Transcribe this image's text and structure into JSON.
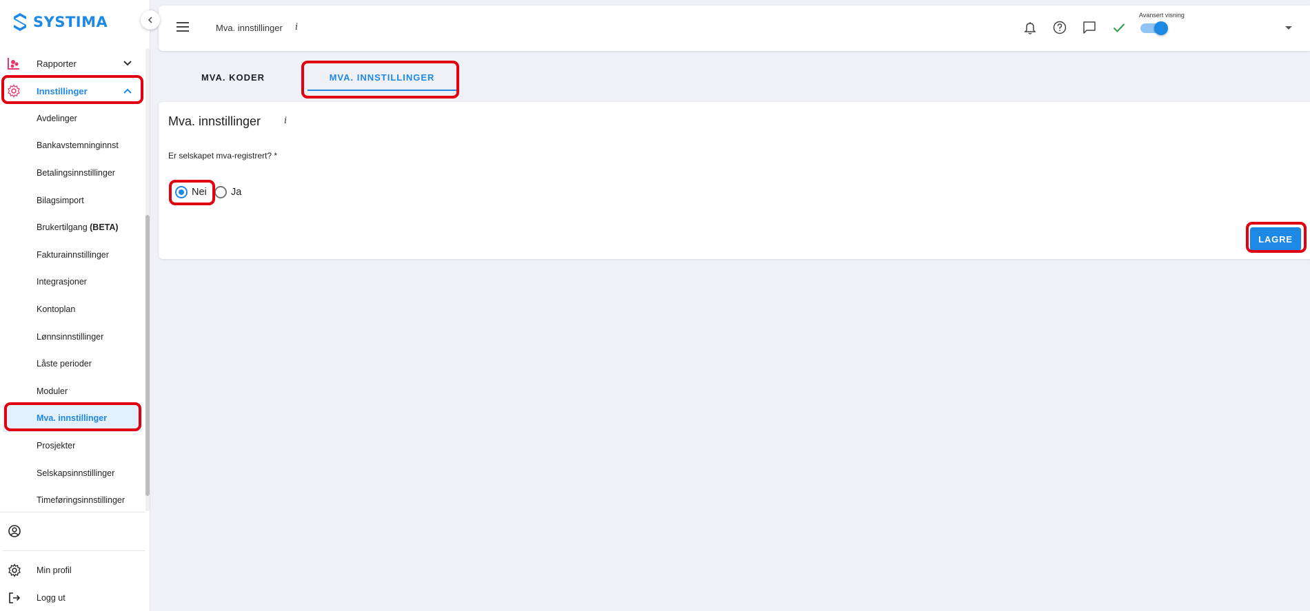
{
  "app": {
    "logo_text": "SYSTIMA"
  },
  "sidebar": {
    "sections": [
      {
        "label": "Rapporter",
        "icon": "bar-chart-icon",
        "expanded": false
      },
      {
        "label": "Innstillinger",
        "icon": "gear-icon",
        "expanded": true
      }
    ],
    "settings_items": [
      {
        "label": "Avdelinger"
      },
      {
        "label": "Bankavstemninginnst"
      },
      {
        "label": "Betalingsinnstillinger"
      },
      {
        "label": "Bilagsimport"
      },
      {
        "label": "Brukertilgang ",
        "badge": "(BETA)"
      },
      {
        "label": "Fakturainnstillinger"
      },
      {
        "label": "Integrasjoner"
      },
      {
        "label": "Kontoplan"
      },
      {
        "label": "Lønnsinnstillinger"
      },
      {
        "label": "Låste perioder"
      },
      {
        "label": "Moduler"
      },
      {
        "label": "Mva. innstillinger",
        "active": true
      },
      {
        "label": "Prosjekter"
      },
      {
        "label": "Selskapsinnstillinger"
      },
      {
        "label": "Timeføringsinnstillinger"
      }
    ],
    "bottom": {
      "profile_label": "Min profil",
      "logout_label": "Logg ut"
    }
  },
  "topbar": {
    "title": "Mva. innstillinger",
    "info": "i",
    "advanced_view_label": "Avansert visning",
    "advanced_view_on": true
  },
  "tabs": [
    {
      "label": "MVA. KODER",
      "active": false
    },
    {
      "label": "MVA. INNSTILLINGER",
      "active": true
    }
  ],
  "card": {
    "title": "Mva. innstillinger",
    "info": "i",
    "question": "Er selskapet mva-registrert? *",
    "options": [
      {
        "label": "Nei",
        "selected": true
      },
      {
        "label": "Ja",
        "selected": false
      }
    ],
    "save_label": "LAGRE"
  },
  "colors": {
    "accent": "#1e88e5",
    "highlight_box": "#e0000f",
    "success": "#2e9d3f",
    "report_icon": "#e5386b"
  }
}
